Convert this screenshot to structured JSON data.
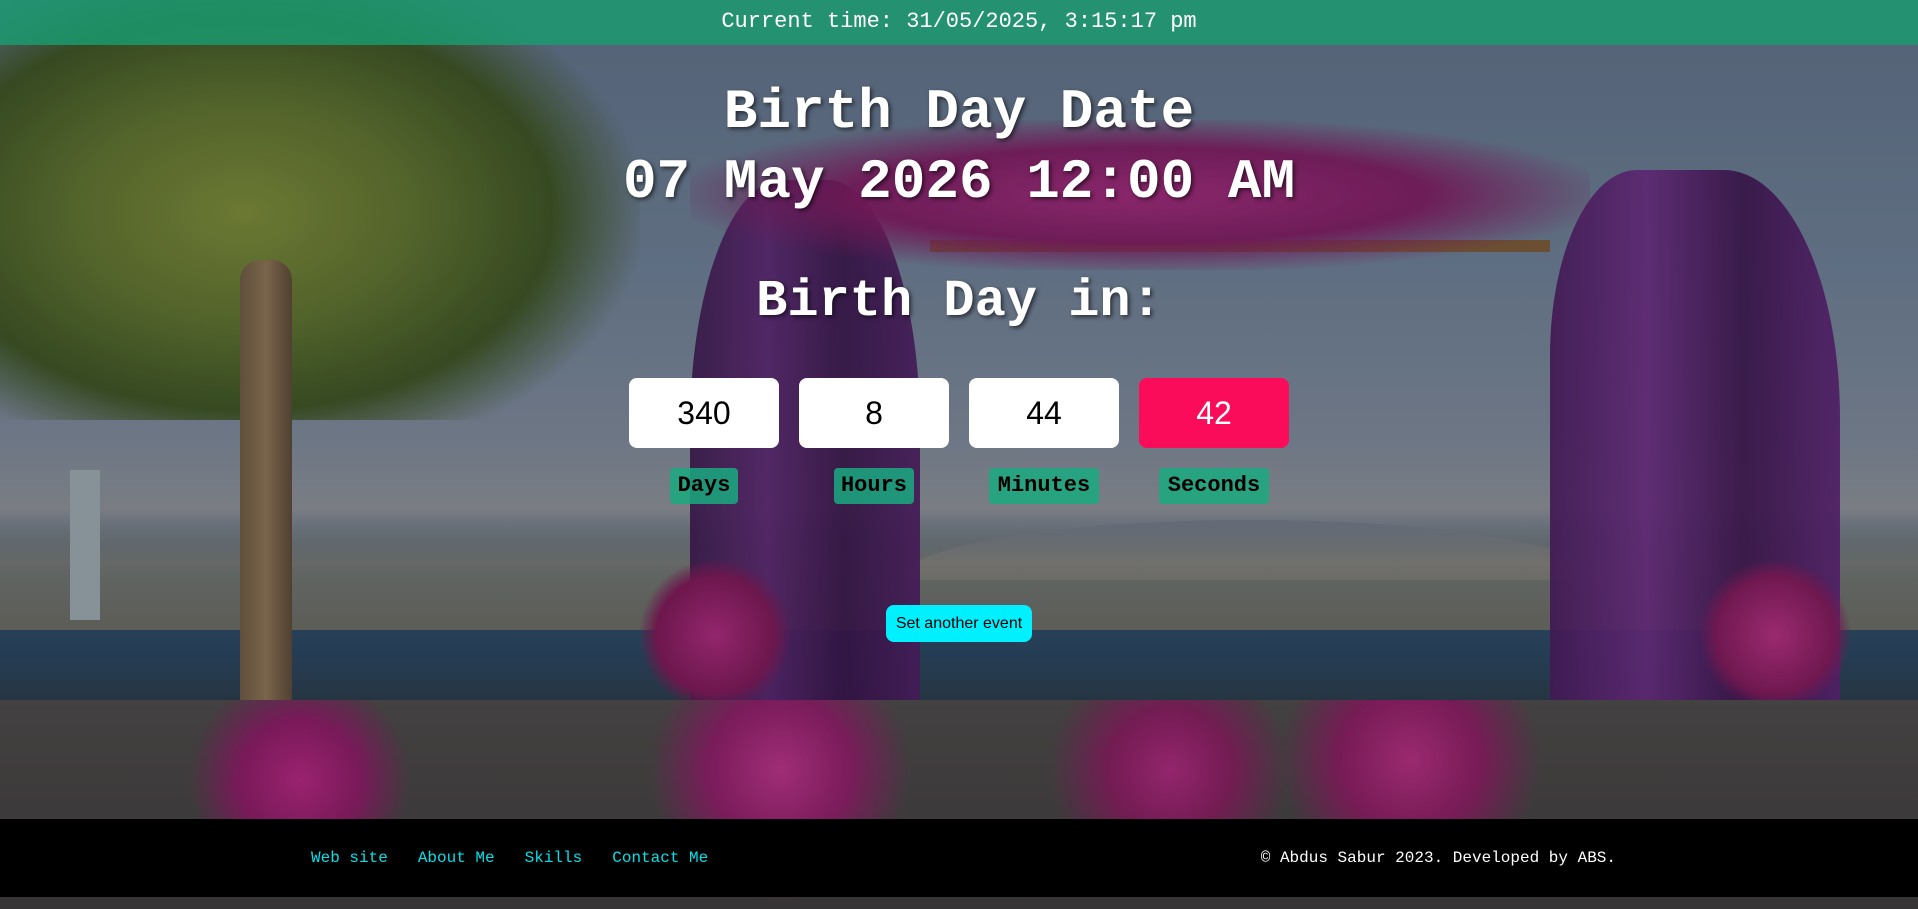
{
  "topbar": {
    "current_time": "Current time: 31/05/2025, 3:15:17 pm"
  },
  "event": {
    "title": "Birth Day Date",
    "date": "07 May 2026 12:00 AM",
    "countdown_heading": "Birth Day in:"
  },
  "countdown": {
    "days": "340",
    "hours": "8",
    "minutes": "44",
    "seconds": "42",
    "labels": {
      "days": "Days",
      "hours": "Hours",
      "minutes": "Minutes",
      "seconds": "Seconds"
    }
  },
  "actions": {
    "set_event_label": "Set another event"
  },
  "footer": {
    "links": [
      "Web site",
      "About Me",
      "Skills",
      "Contact Me"
    ],
    "copyright": "© Abdus Sabur 2023. Developed by ABS."
  },
  "colors": {
    "topbar_bg": "#1a9c70",
    "seconds_accent": "#fb0c5a",
    "button_bg": "#00f0ff",
    "link_color": "#00e0e8",
    "unit_label_bg": "#1aaa80"
  },
  "icons": [
    "background-photo-wedding-arch"
  ]
}
